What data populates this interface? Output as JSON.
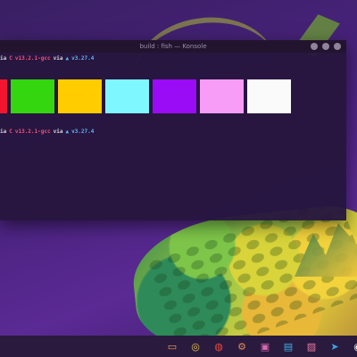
{
  "window": {
    "title": "build : fish — Konsole"
  },
  "terminal": {
    "prompt1": {
      "dir": "ia",
      "symbol": "C",
      "version": "v13.2.1-gcc",
      "via": "via",
      "triangle": "▲",
      "version2": "v3.27.4"
    },
    "prompt2": {
      "dir": "ia",
      "symbol": "C",
      "version": "v13.2.1-gcc",
      "via": "via",
      "triangle": "▲",
      "version2": "v3.27.4"
    },
    "swatch_colors": [
      "#f2152f",
      "#33d60f",
      "#ffcc00",
      "#7ff7ff",
      "#9a0cf5",
      "#f79cf7",
      "#fafafa"
    ]
  },
  "dock": {
    "icons": [
      {
        "name": "folder-icon",
        "glyph": "▭",
        "color": "#f0a14a"
      },
      {
        "name": "chrome-icon",
        "glyph": "◎",
        "color": "#e9c94a"
      },
      {
        "name": "palette-icon",
        "glyph": "◍",
        "color": "#e84d3d"
      },
      {
        "name": "settings-icon",
        "glyph": "⚙",
        "color": "#e08a5a"
      },
      {
        "name": "store-icon",
        "glyph": "▣",
        "color": "#d46ab0"
      },
      {
        "name": "monitor-icon",
        "glyph": "▤",
        "color": "#3ab0e6"
      },
      {
        "name": "image-icon",
        "glyph": "▨",
        "color": "#e97aa0"
      },
      {
        "name": "telegram-icon",
        "glyph": "➤",
        "color": "#3aa8e6"
      },
      {
        "name": "terminal-icon",
        "glyph": "◉",
        "color": "#f0f0f0"
      }
    ]
  }
}
